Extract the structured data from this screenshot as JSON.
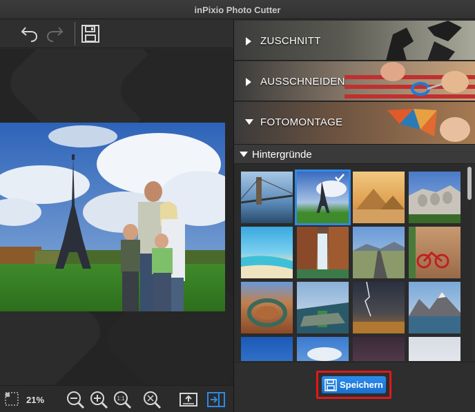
{
  "window": {
    "title": "inPixio Photo Cutter"
  },
  "toolbar": {
    "undo_icon": "undo-arrow-icon",
    "redo_icon": "redo-arrow-icon",
    "save_icon": "floppy-disk-icon"
  },
  "statusbar": {
    "zoom": "21%",
    "zoom_out_icon": "zoom-out-icon",
    "zoom_in_icon": "zoom-in-icon",
    "zoom_1to1_label": "1:1",
    "fit_icon": "fit-to-window-icon",
    "export_icon": "export-icon",
    "panel_icon": "toggle-panel-icon"
  },
  "panel": {
    "sections": [
      {
        "label": "ZUSCHNITT",
        "expanded": false
      },
      {
        "label": "AUSSCHNEIDEN",
        "expanded": false
      },
      {
        "label": "FOTOMONTAGE",
        "expanded": true
      }
    ],
    "subsection": {
      "label": "Hintergründe"
    },
    "thumbnails": [
      "brooklyn-bridge",
      "eiffel-tower",
      "pyramids",
      "mount-rushmore",
      "tropical-beach",
      "waterfall",
      "desert-road",
      "red-bicycle",
      "horseshoe-bend",
      "lighthouse-coast",
      "lightning-storm",
      "mountain-lake",
      "blue-sky",
      "blue-sky-2",
      "sunset",
      "sky-bird"
    ],
    "selected_index": 1
  },
  "footer": {
    "save_label": "Speichern"
  },
  "colors": {
    "accent": "#2f8ae5",
    "highlight": "#e01919"
  }
}
